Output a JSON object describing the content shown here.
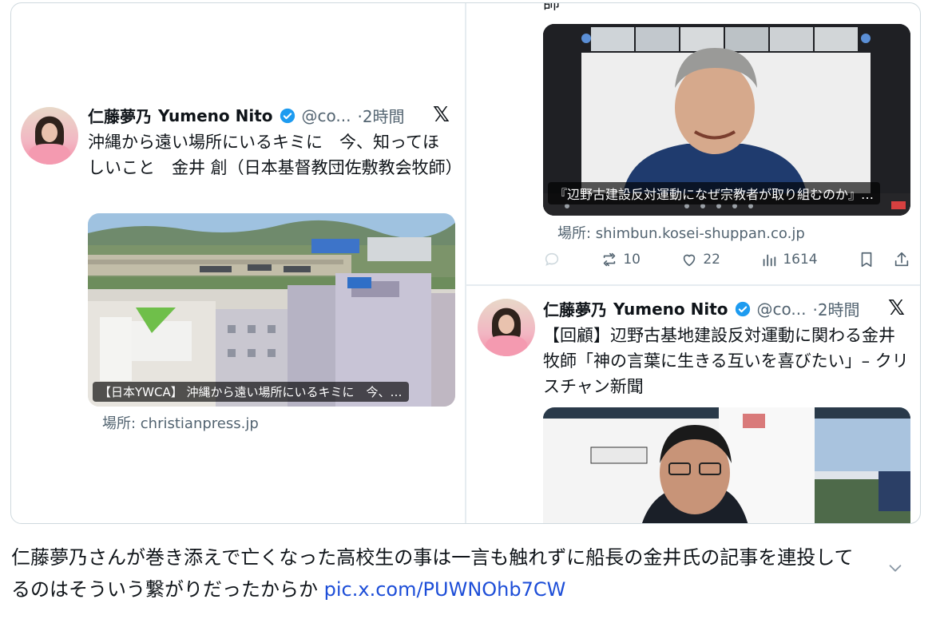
{
  "left_tweet": {
    "name": "仁藤夢乃",
    "name_en": "Yumeno Nito",
    "handle": "@co...",
    "time": "·2時間",
    "text": "沖縄から遠い場所にいるキミに　今、知ってほしいこと　金井 創（日本基督教団佐敷教会牧師）",
    "media_caption": "【日本YWCA】 沖縄から遠い場所にいるキミに　今、…",
    "source": "場所: christianpress.jp"
  },
  "right_top_tweet": {
    "partial_text": "師",
    "video_caption": "『辺野古建設反対運動になぜ宗教者が取り組むのか』…",
    "source": "場所: shimbun.kosei-shuppan.co.jp",
    "retweets": "10",
    "likes": "22",
    "views": "1614"
  },
  "right_bottom_tweet": {
    "name": "仁藤夢乃",
    "name_en": "Yumeno Nito",
    "handle": "@co...",
    "time": "·2時間",
    "text": "【回顧】辺野古基地建設反対運動に関わる金井牧師「神の言葉に生きる互いを喜びたい」– クリスチャン新聞"
  },
  "post_caption": {
    "text": "仁藤夢乃さんが巻き添えで亡くなった高校生の事は一言も触れずに船長の金井氏の記事を連投してるのはそういう繋がりだったからか ",
    "link": "pic.x.com/PUWNOhb7CW"
  },
  "icons": {
    "verified": "verified-badge-icon",
    "x_logo": "x-logo-icon",
    "reply": "reply-icon",
    "retweet": "retweet-icon",
    "like": "heart-icon",
    "views": "views-icon",
    "bookmark": "bookmark-icon",
    "share": "share-icon",
    "chevron": "chevron-down-icon"
  },
  "colors": {
    "verified": "#1d9bf0",
    "link": "#1d4ed8",
    "secondary_text": "#536471"
  }
}
